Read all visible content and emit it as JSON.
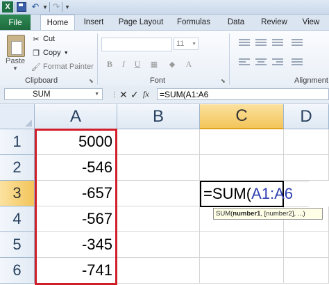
{
  "quick_access": {
    "app_icon": "excel-icon",
    "app_letter": "X",
    "icons": [
      "save-icon",
      "undo-icon",
      "dropdown-arrow-icon",
      "redo-icon",
      "customize-icon"
    ]
  },
  "tabs": {
    "file": "File",
    "items": [
      "Home",
      "Insert",
      "Page Layout",
      "Formulas",
      "Data",
      "Review",
      "View"
    ],
    "active": "Home"
  },
  "ribbon": {
    "clipboard": {
      "paste_label": "Paste",
      "cut_label": "Cut",
      "copy_label": "Copy",
      "format_painter_label": "Format Painter",
      "group_label": "Clipboard"
    },
    "font": {
      "font_name": "",
      "font_size": "11",
      "bold": "B",
      "italic": "I",
      "underline": "U",
      "group_label": "Font"
    },
    "alignment": {
      "group_label": "Alignment"
    }
  },
  "formula_bar": {
    "name_box": "SUM",
    "cancel_symbol": "✕",
    "enter_symbol": "✓",
    "fx_label": "fx",
    "formula": "=SUM(A1:A6"
  },
  "grid": {
    "columns": [
      "A",
      "B",
      "C",
      "D"
    ],
    "selected_column": "C",
    "rows": [
      "1",
      "2",
      "3",
      "4",
      "5",
      "6"
    ],
    "selected_row": "3",
    "column_a_values": [
      "5000",
      "-546",
      "-657",
      "-567",
      "-345",
      "-741"
    ],
    "editing_cell": {
      "prefix": "=SUM(",
      "range_ref": "A1:A6"
    },
    "tooltip": {
      "func": "SUM(",
      "arg1": "number1",
      "rest": ", [number2], ...)"
    }
  },
  "colors": {
    "file_tab": "#217346",
    "range_highlight": "#d11f2a",
    "selected_header": "#f3c55a",
    "range_ref_text": "#2f3fb0"
  }
}
